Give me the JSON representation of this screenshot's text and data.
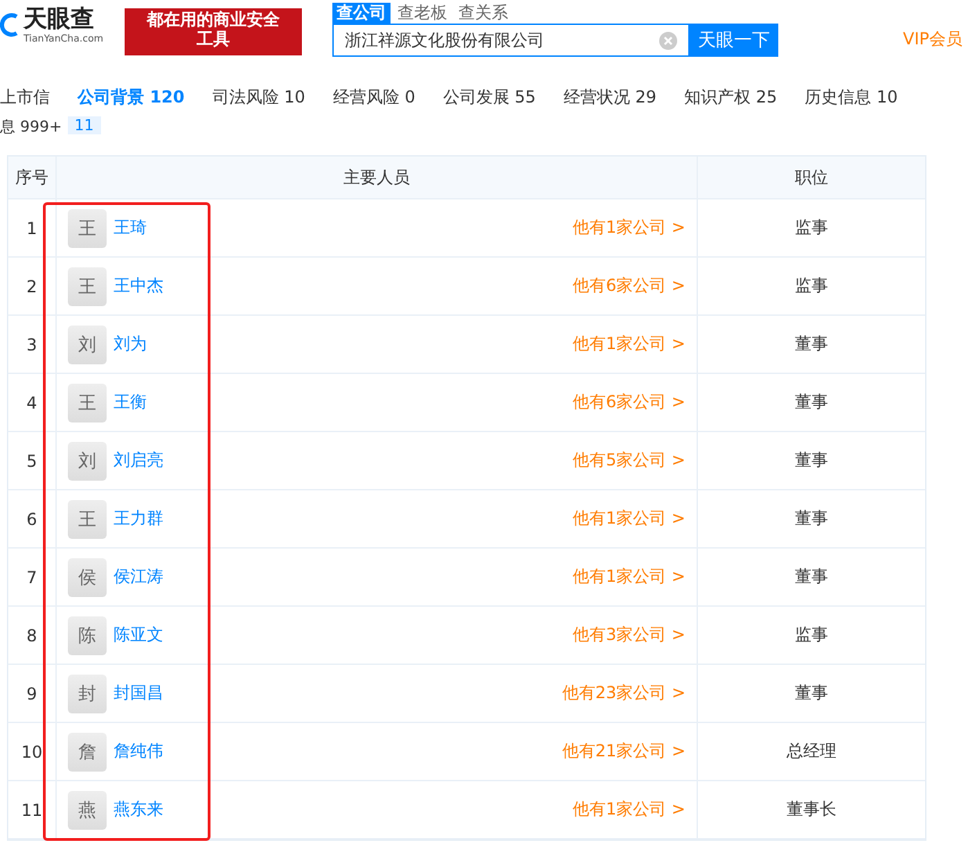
{
  "header": {
    "logo_text": "天眼查",
    "logo_domain": "TianYanCha.com",
    "banner_lines": [
      "都在用的商业安全",
      "工具"
    ],
    "search_tabs": [
      {
        "label": "查公司",
        "selected": true
      },
      {
        "label": "查老板",
        "selected": false
      },
      {
        "label": "查关系",
        "selected": false
      }
    ],
    "search": {
      "value": "浙江祥源文化股份有限公司",
      "button": "天眼一下"
    },
    "vip": "VIP会员"
  },
  "nav": {
    "left_cut": "上市信",
    "items": [
      {
        "label": "公司背景",
        "count": "120",
        "selected": true
      },
      {
        "label": "司法风险",
        "count": "10",
        "selected": false
      },
      {
        "label": "经营风险",
        "count": "0",
        "selected": false
      },
      {
        "label": "公司发展",
        "count": "55",
        "selected": false
      },
      {
        "label": "经营状况",
        "count": "29",
        "selected": false
      },
      {
        "label": "知识产权",
        "count": "25",
        "selected": false
      },
      {
        "label": "历史信息",
        "count": "10",
        "selected": false
      }
    ]
  },
  "section": {
    "left_cut": "息 999+",
    "count": "11"
  },
  "table": {
    "columns": [
      "序号",
      "主要人员",
      "职位"
    ],
    "rows": [
      {
        "index": "1",
        "avatar": "王",
        "name": "王琦",
        "companies": "他有1家公司 >",
        "position": "监事"
      },
      {
        "index": "2",
        "avatar": "王",
        "name": "王中杰",
        "companies": "他有6家公司 >",
        "position": "监事"
      },
      {
        "index": "3",
        "avatar": "刘",
        "name": "刘为",
        "companies": "他有1家公司 >",
        "position": "董事"
      },
      {
        "index": "4",
        "avatar": "王",
        "name": "王衡",
        "companies": "他有6家公司 >",
        "position": "董事"
      },
      {
        "index": "5",
        "avatar": "刘",
        "name": "刘启亮",
        "companies": "他有5家公司 >",
        "position": "董事"
      },
      {
        "index": "6",
        "avatar": "王",
        "name": "王力群",
        "companies": "他有1家公司 >",
        "position": "董事"
      },
      {
        "index": "7",
        "avatar": "侯",
        "name": "侯江涛",
        "companies": "他有1家公司 >",
        "position": "董事"
      },
      {
        "index": "8",
        "avatar": "陈",
        "name": "陈亚文",
        "companies": "他有3家公司 >",
        "position": "监事"
      },
      {
        "index": "9",
        "avatar": "封",
        "name": "封国昌",
        "companies": "他有23家公司 >",
        "position": "董事"
      },
      {
        "index": "10",
        "avatar": "詹",
        "name": "詹纯伟",
        "companies": "他有21家公司 >",
        "position": "总经理"
      },
      {
        "index": "11",
        "avatar": "燕",
        "name": "燕东来",
        "companies": "他有1家公司 >",
        "position": "董事长"
      }
    ]
  }
}
